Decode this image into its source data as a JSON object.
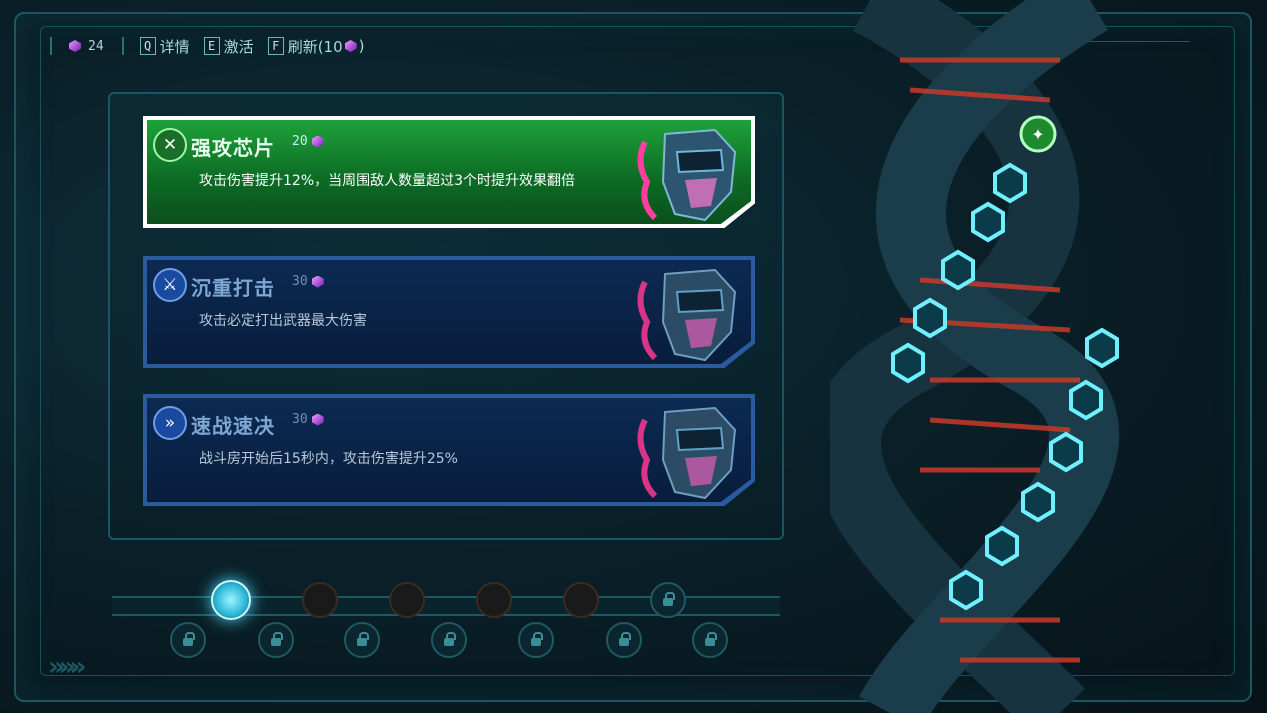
{
  "topbar": {
    "currency_count": "24",
    "commands": [
      {
        "key": "Q",
        "label": "详情"
      },
      {
        "key": "E",
        "label": "激活"
      },
      {
        "key": "F",
        "label": "刷新(10",
        "suffix": ")"
      }
    ]
  },
  "cards": [
    {
      "name": "强攻芯片",
      "cost": "20",
      "description": "攻击伤害提升12%，当周围敌人数量超过3个时提升效果翻倍",
      "state": "selected",
      "icon": "crossed-guns-icon"
    },
    {
      "name": "沉重打击",
      "cost": "30",
      "description": "攻击必定打出武器最大伤害",
      "state": "normal",
      "icon": "sword-icon"
    },
    {
      "name": "速战速决",
      "cost": "30",
      "description": "战斗房开始后15秒内，攻击伤害提升25%",
      "state": "normal",
      "icon": "speed-icon"
    }
  ],
  "loadout": {
    "top_row": [
      "active",
      "character",
      "character",
      "character",
      "character",
      "locked"
    ],
    "bottom_row": [
      "locked",
      "locked",
      "locked",
      "locked",
      "locked",
      "locked",
      "locked"
    ]
  },
  "colors": {
    "selected_card": "#1ea23a",
    "normal_card": "#0c2a52",
    "accent_cyan": "#4fdcff",
    "currency_gem": "#a64bd6"
  }
}
